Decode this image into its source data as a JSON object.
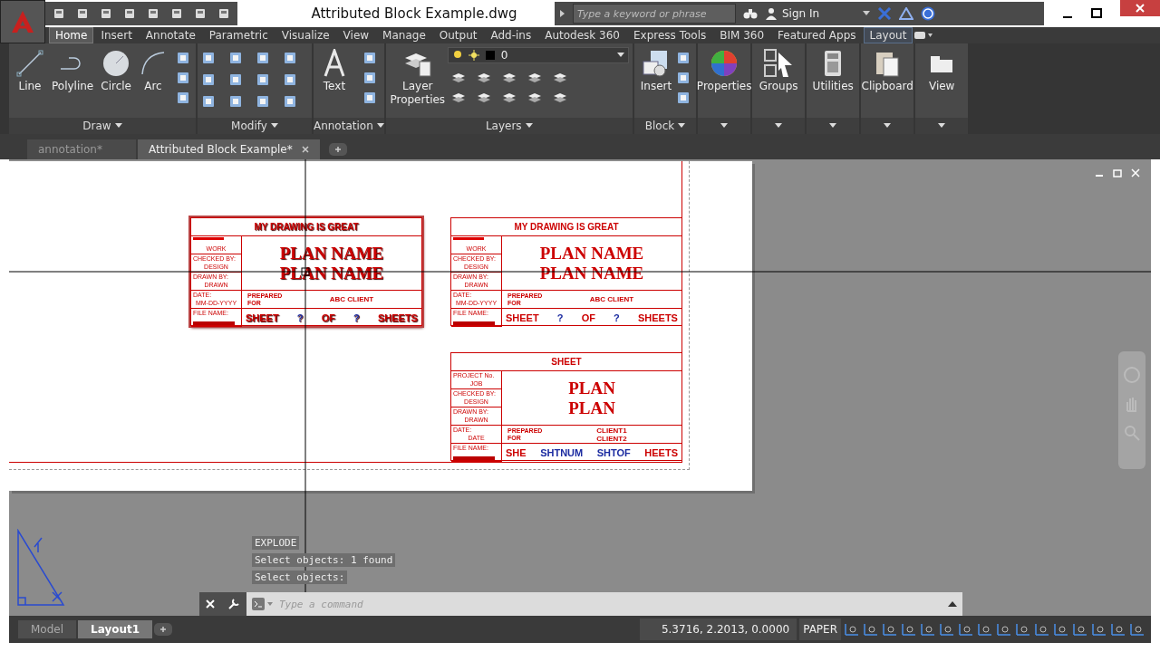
{
  "window": {
    "title": "Attributed Block Example.dwg"
  },
  "search": {
    "placeholder": "Type a keyword or phrase"
  },
  "account": {
    "label": "Sign In"
  },
  "ribbon_tabs": [
    {
      "label": "Home",
      "selected": true,
      "kind": "standard"
    },
    {
      "label": "Insert",
      "selected": false,
      "kind": "standard"
    },
    {
      "label": "Annotate",
      "selected": false,
      "kind": "standard"
    },
    {
      "label": "Parametric",
      "selected": false,
      "kind": "standard"
    },
    {
      "label": "Visualize",
      "selected": false,
      "kind": "standard"
    },
    {
      "label": "View",
      "selected": false,
      "kind": "standard"
    },
    {
      "label": "Manage",
      "selected": false,
      "kind": "standard"
    },
    {
      "label": "Output",
      "selected": false,
      "kind": "standard"
    },
    {
      "label": "Add-ins",
      "selected": false,
      "kind": "standard"
    },
    {
      "label": "Autodesk 360",
      "selected": false,
      "kind": "standard"
    },
    {
      "label": "Express Tools",
      "selected": false,
      "kind": "standard"
    },
    {
      "label": "BIM 360",
      "selected": false,
      "kind": "standard"
    },
    {
      "label": "Featured Apps",
      "selected": false,
      "kind": "standard"
    },
    {
      "label": "Layout",
      "selected": false,
      "kind": "contextual"
    }
  ],
  "ribbon_panels": [
    {
      "kind": "draw",
      "title": "Draw",
      "tools": [
        {
          "label": "Line",
          "kind": "line"
        },
        {
          "label": "Polyline",
          "kind": "polyline"
        },
        {
          "label": "Circle",
          "kind": "circle"
        },
        {
          "label": "Arc",
          "kind": "arc"
        }
      ]
    },
    {
      "kind": "modify",
      "title": "Modify"
    },
    {
      "kind": "annotation",
      "title": "Annotation",
      "tools": [
        {
          "label": "Text",
          "kind": "text"
        }
      ]
    },
    {
      "kind": "layers",
      "title": "Layers",
      "layer": "0",
      "tools": [
        {
          "label": "Layer Properties",
          "kind": "layer-properties"
        }
      ]
    },
    {
      "kind": "block",
      "title": "Block",
      "tools": [
        {
          "label": "Insert",
          "kind": "insert"
        }
      ]
    },
    {
      "kind": "single",
      "tools": [
        {
          "label": "Properties",
          "kind": "properties"
        }
      ]
    },
    {
      "kind": "single",
      "tools": [
        {
          "label": "Groups",
          "kind": "groups"
        }
      ]
    },
    {
      "kind": "single",
      "tools": [
        {
          "label": "Utilities",
          "kind": "utilities"
        }
      ]
    },
    {
      "kind": "single",
      "tools": [
        {
          "label": "Clipboard",
          "kind": "clipboard"
        }
      ]
    },
    {
      "kind": "single",
      "tools": [
        {
          "label": "View",
          "kind": "view"
        }
      ]
    }
  ],
  "document_tabs": [
    {
      "label": "annotation*",
      "selected": false
    },
    {
      "label": "Attributed Block Example*",
      "selected": true
    }
  ],
  "title_blocks": [
    {
      "selected": true,
      "header": "MY DRAWING IS GREAT",
      "fields": [
        {
          "value": "WORK"
        },
        {
          "label": "CHECKED BY:",
          "value": "DESIGN"
        },
        {
          "label": "DRAWN BY:",
          "value": "DRAWN"
        },
        {
          "label": "DATE:",
          "value": "MM-DD-YYYY"
        },
        {
          "label": "FILE NAME:"
        }
      ],
      "plan": [
        "PLAN NAME",
        "PLAN NAME"
      ],
      "prepared": "PREPARED FOR",
      "client": [
        "ABC CLIENT"
      ],
      "sheet": [
        {
          "text": "SHEET",
          "kind": "static"
        },
        {
          "text": "?",
          "kind": "attribute"
        },
        {
          "text": "OF",
          "kind": "static"
        },
        {
          "text": "?",
          "kind": "attribute"
        },
        {
          "text": "SHEETS",
          "kind": "static"
        }
      ]
    },
    {
      "selected": false,
      "header": "MY DRAWING IS GREAT",
      "fields": [
        {
          "value": "WORK"
        },
        {
          "label": "CHECKED BY:",
          "value": "DESIGN"
        },
        {
          "label": "DRAWN BY:",
          "value": "DRAWN"
        },
        {
          "label": "DATE:",
          "value": "MM-DD-YYYY"
        },
        {
          "label": "FILE NAME:"
        }
      ],
      "plan": [
        "PLAN NAME",
        "PLAN NAME"
      ],
      "prepared": "PREPARED FOR",
      "client": [
        "ABC CLIENT"
      ],
      "sheet": [
        {
          "text": "SHEET",
          "kind": "static"
        },
        {
          "text": "?",
          "kind": "attribute"
        },
        {
          "text": "OF",
          "kind": "static"
        },
        {
          "text": "?",
          "kind": "attribute"
        },
        {
          "text": "SHEETS",
          "kind": "static"
        }
      ]
    },
    {
      "selected": false,
      "header": "SHEET",
      "fields": [
        {
          "label": "PROJECT No.",
          "value": "JOB"
        },
        {
          "label": "CHECKED BY:",
          "value": "DESIGN"
        },
        {
          "label": "DRAWN BY:",
          "value": "DRAWN"
        },
        {
          "label": "DATE:",
          "value": "DATE"
        },
        {
          "label": "FILE NAME:"
        }
      ],
      "plan": [
        "PLAN",
        "PLAN"
      ],
      "prepared": "PREPARED FOR",
      "client": [
        "CLIENT1",
        "CLIENT2"
      ],
      "sheet": [
        {
          "text": "SHE",
          "kind": "static"
        },
        {
          "text": "SHTNUM",
          "kind": "attribute"
        },
        {
          "text": "SHTOF",
          "kind": "attribute"
        },
        {
          "text": "HEETS",
          "kind": "static"
        }
      ]
    }
  ],
  "command_history": [
    "EXPLODE",
    "Select objects: 1 found",
    "Select objects:"
  ],
  "command_line": {
    "placeholder": "Type a command"
  },
  "layout_tabs": [
    {
      "label": "Model",
      "selected": false
    },
    {
      "label": "Layout1",
      "selected": true
    }
  ],
  "status_bar": {
    "coordinates": "5.3716, 2.2013, 0.0000",
    "space": "PAPER"
  }
}
